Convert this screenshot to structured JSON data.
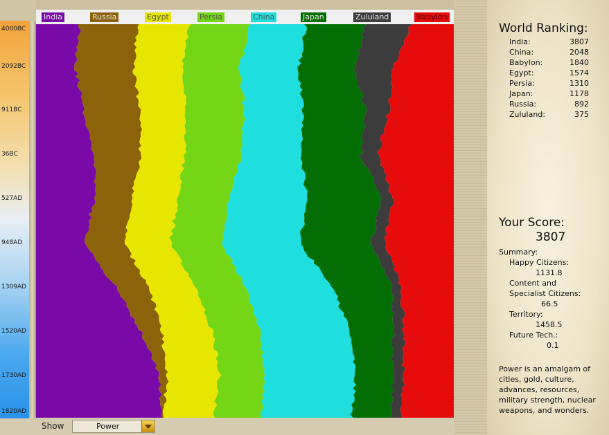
{
  "timeline": {
    "ticks": [
      "4000BC",
      "2092BC",
      "911BC",
      "36BC",
      "527AD",
      "948AD",
      "1309AD",
      "1520AD",
      "1730AD",
      "1820AD"
    ]
  },
  "legend": [
    {
      "name": "India",
      "color": "#7a0aa8"
    },
    {
      "name": "Russia",
      "color": "#8c620a"
    },
    {
      "name": "Egypt",
      "color": "#e6e600"
    },
    {
      "name": "Persia",
      "color": "#74d615"
    },
    {
      "name": "China",
      "color": "#1edede"
    },
    {
      "name": "Japan",
      "color": "#036e03"
    },
    {
      "name": "Zululand",
      "color": "#3c3c3c"
    },
    {
      "name": "Babylon",
      "color": "#e60c0c"
    }
  ],
  "chart_data": {
    "type": "area",
    "stacked": true,
    "normalized": true,
    "x": [
      "4000BC",
      "2092BC",
      "911BC",
      "36BC",
      "527AD",
      "948AD",
      "1309AD",
      "1520AD",
      "1730AD",
      "1820AD"
    ],
    "series": [
      {
        "name": "India",
        "values": [
          10.6,
          9.5,
          11.5,
          14,
          14,
          11.5,
          19,
          25,
          29.5,
          30
        ]
      },
      {
        "name": "Russia",
        "values": [
          13.8,
          13.8,
          13.4,
          11,
          9,
          9.5,
          8,
          5,
          2,
          0.5
        ]
      },
      {
        "name": "Egypt",
        "values": [
          12.4,
          11.5,
          11,
          10.5,
          11,
          11,
          11,
          12,
          12.5,
          12
        ]
      },
      {
        "name": "Persia",
        "values": [
          14.3,
          14,
          14,
          13.5,
          12,
          12.5,
          12,
          11.5,
          11,
          11.5
        ]
      },
      {
        "name": "China",
        "values": [
          13.6,
          14,
          14,
          14.5,
          19,
          18.5,
          21,
          21.5,
          21.5,
          21.5
        ]
      },
      {
        "name": "Japan",
        "values": [
          14.1,
          13.5,
          15,
          14.3,
          18,
          17,
          14,
          10.5,
          9,
          9.5
        ]
      },
      {
        "name": "Zululand",
        "values": [
          11,
          9,
          5.5,
          4,
          2.5,
          3.5,
          2.5,
          2.5,
          2.5,
          2.5
        ]
      },
      {
        "name": "Babylon",
        "values": [
          10.2,
          14.7,
          15.6,
          18.2,
          14.5,
          16.5,
          12.5,
          12,
          12,
          12.5
        ]
      }
    ],
    "ylabel": "",
    "xlabel": ""
  },
  "panel": {
    "ranking_title": "World Ranking:",
    "ranking": [
      {
        "name": "India:",
        "value": "3807"
      },
      {
        "name": "China:",
        "value": "2048"
      },
      {
        "name": "Babylon:",
        "value": "1840"
      },
      {
        "name": "Egypt:",
        "value": "1574"
      },
      {
        "name": "Persia:",
        "value": "1310"
      },
      {
        "name": "Japan:",
        "value": "1178"
      },
      {
        "name": "Russia:",
        "value": "892"
      },
      {
        "name": "Zululand:",
        "value": "375"
      }
    ],
    "score_title": "Your Score:",
    "score": "3807",
    "summary_label": "Summary:",
    "happy_label": "Happy Citizens:",
    "happy_value": "1131.8",
    "content_label_1": "Content and",
    "content_label_2": "Specialist Citizens:",
    "content_value": "66.5",
    "territory_label": "Territory:",
    "territory_value": "1458.5",
    "future_label": "Future Tech.:",
    "future_value": "0.1",
    "power_text": [
      "Power is an amalgam of",
      "cities, gold, culture,",
      "advances, resources,",
      "military strength, nuclear",
      "weapons, and wonders."
    ]
  },
  "bottom": {
    "show_label": "Show",
    "select_value": "Power"
  }
}
